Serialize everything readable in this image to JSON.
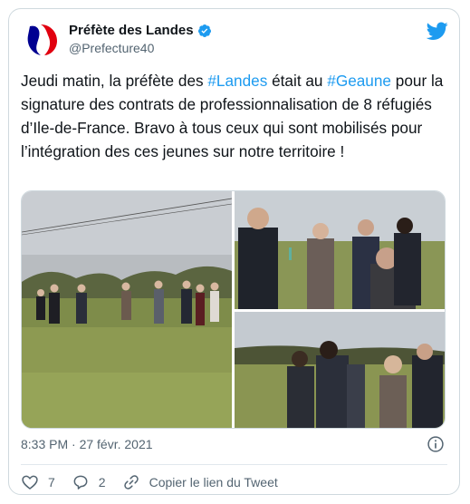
{
  "author": {
    "display_name": "Préfète des Landes",
    "handle": "@Prefecture40"
  },
  "tweet": {
    "segments": [
      {
        "text": "Jeudi matin, la préfète des ",
        "type": "text"
      },
      {
        "text": "#Landes",
        "type": "hashtag"
      },
      {
        "text": " était au ",
        "type": "text"
      },
      {
        "text": "#Geaune",
        "type": "hashtag"
      },
      {
        "text": " pour la signature des contrats de professionnalisation de 8 réfugiés d’Ile-de-France. Bravo à tous ceux qui sont mobilisés pour l’intégration des ces jeunes sur notre territoire !",
        "type": "text"
      }
    ]
  },
  "meta": {
    "timestamp": "8:33 PM · 27 févr. 2021"
  },
  "actions": {
    "likes": "7",
    "replies": "2",
    "copy_link_label": "Copier le lien du Tweet"
  },
  "colors": {
    "accent": "#1d9bf0",
    "text": "#0f1419",
    "secondary": "#536471"
  },
  "icons": [
    "verified-badge-icon",
    "twitter-bird-icon",
    "info-icon",
    "heart-icon",
    "reply-icon",
    "link-icon"
  ]
}
